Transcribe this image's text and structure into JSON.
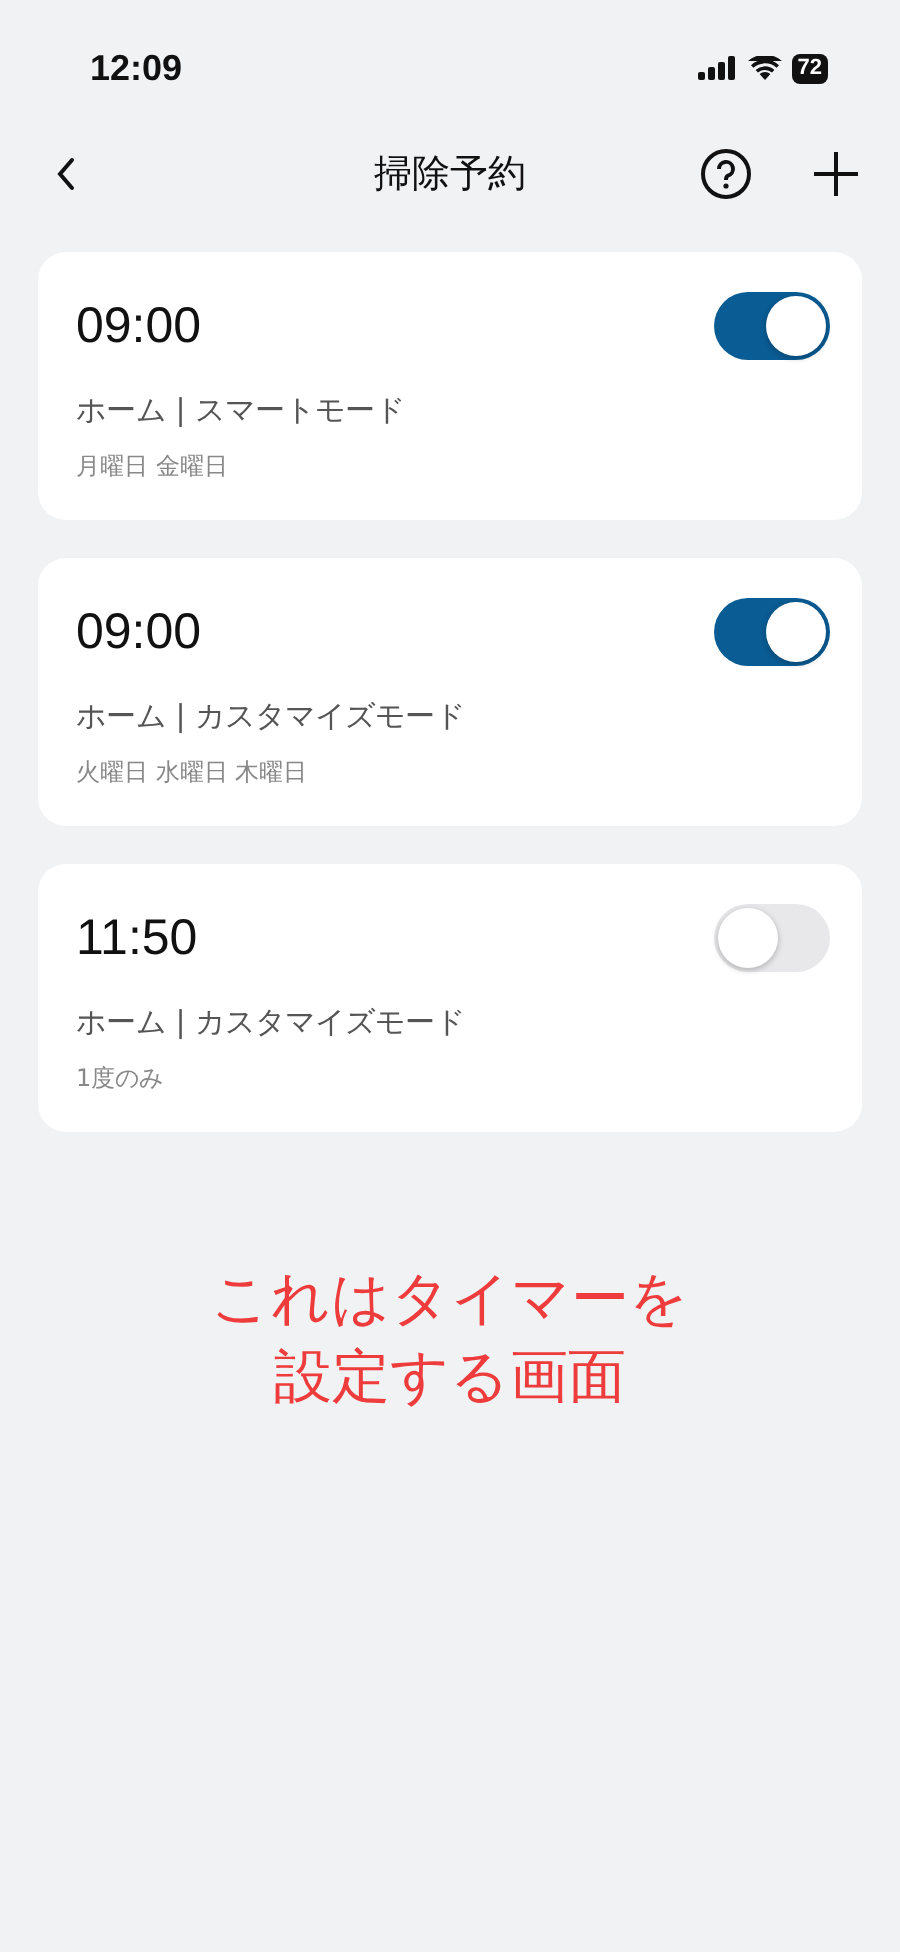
{
  "status_bar": {
    "time": "12:09",
    "battery": "72"
  },
  "header": {
    "title": "掃除予約"
  },
  "schedules": [
    {
      "time": "09:00",
      "mode": "ホーム | スマートモード",
      "days": "月曜日 金曜日",
      "on": true
    },
    {
      "time": "09:00",
      "mode": "ホーム | カスタマイズモード",
      "days": "火曜日 水曜日 木曜日",
      "on": true
    },
    {
      "time": "11:50",
      "mode": "ホーム | カスタマイズモード",
      "days": "1度のみ",
      "on": false
    }
  ],
  "annotation": [
    "これはタイマーを",
    "設定する画面"
  ]
}
